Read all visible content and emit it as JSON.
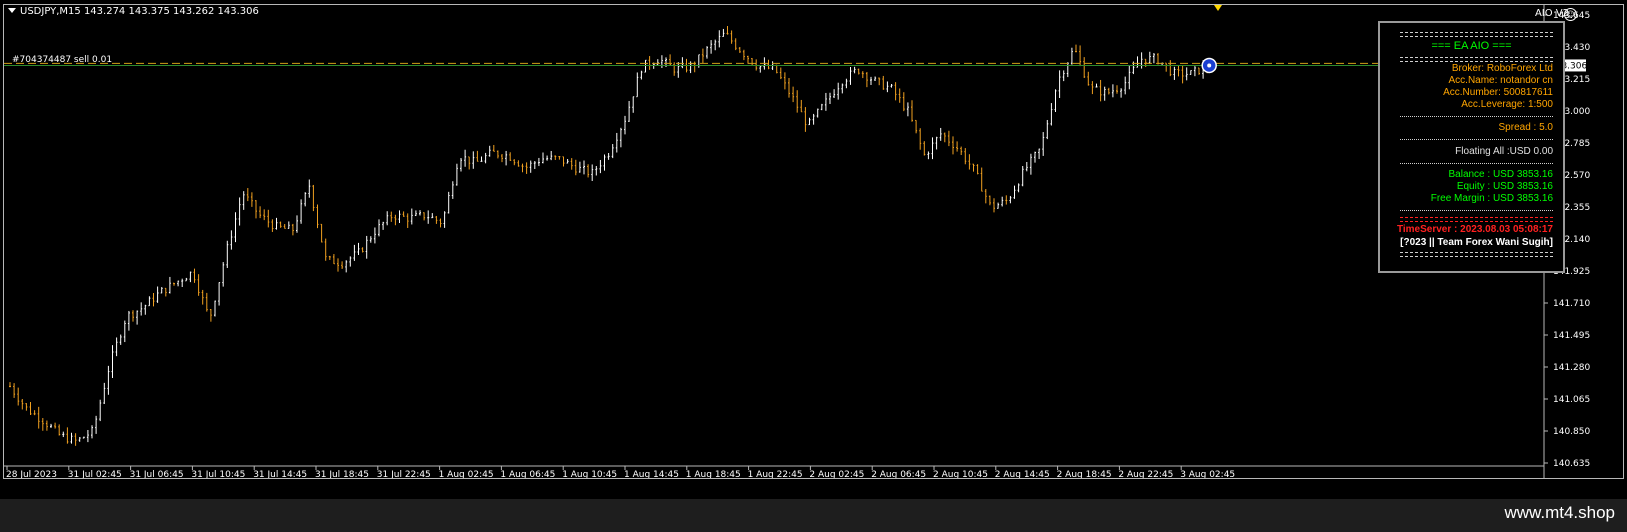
{
  "header": {
    "symbol_line": "USDJPY,M15  143.274 143.375 143.262 143.306",
    "ea_name": "AIO V2"
  },
  "order_label": "#704374487 sell 0.01",
  "watermark": "www.mt4.shop",
  "colors": {
    "background": "#000000",
    "bull_candle": "#ffffff",
    "bear_candle": "#f0a020",
    "order_line": "#d4a017",
    "bid_line": "#2e8b2e",
    "panel_title": "#00ff00",
    "panel_orange": "#ffa500",
    "panel_red": "#ff2020"
  },
  "info_panel": {
    "top_sep": "============================",
    "title": "=== EA AIO ===",
    "sep2": "============================",
    "broker": "Broker: RoboForex Ltd",
    "acc_name": "Acc.Name: notandor cn",
    "acc_number": "Acc.Number: 500817611",
    "acc_leverage": "Acc.Leverage: 1:500",
    "spread": "Spread :  5.0",
    "floating": "Floating All  :USD 0.00",
    "balance": "Balance  : USD 3853.16",
    "equity": "Equity  : USD 3853.16",
    "free_margin": "Free Margin : USD 3853.16",
    "red_sep": "============================",
    "time_server": "TimeServer : 2023.08.03 05:08:17",
    "team": "[?023 || Team Forex Wani Sugih]",
    "bottom_sep": "============================"
  },
  "chart_data": {
    "type": "candlestick",
    "symbol": "USDJPY",
    "timeframe": "M15",
    "current_price": 143.306,
    "order_price": 143.32,
    "ylim": [
      140.6,
      143.68
    ],
    "y_ticks": [
      "143.645",
      "143.430",
      "143.215",
      "143.000",
      "142.785",
      "142.570",
      "142.355",
      "142.140",
      "141.925",
      "141.710",
      "141.495",
      "141.280",
      "141.065",
      "140.850",
      "140.635"
    ],
    "current_price_label": "143.306",
    "x_ticks": [
      "28 Jul 2023",
      "31 Jul 02:45",
      "31 Jul 06:45",
      "31 Jul 10:45",
      "31 Jul 14:45",
      "31 Jul 18:45",
      "31 Jul 22:45",
      "1 Aug 02:45",
      "1 Aug 06:45",
      "1 Aug 10:45",
      "1 Aug 14:45",
      "1 Aug 18:45",
      "1 Aug 22:45",
      "2 Aug 02:45",
      "2 Aug 06:45",
      "2 Aug 10:45",
      "2 Aug 14:45",
      "2 Aug 18:45",
      "2 Aug 22:45",
      "3 Aug 02:45"
    ],
    "path_closes": [
      141.15,
      141.0,
      140.92,
      140.82,
      140.78,
      140.85,
      141.3,
      141.62,
      141.68,
      141.78,
      141.85,
      141.92,
      141.6,
      142.05,
      142.45,
      142.3,
      142.22,
      142.2,
      142.5,
      142.0,
      141.98,
      142.05,
      142.2,
      142.3,
      142.28,
      142.3,
      142.25,
      142.7,
      142.65,
      142.72,
      142.7,
      142.62,
      142.68,
      142.68,
      142.62,
      142.58,
      142.72,
      142.95,
      143.3,
      143.35,
      143.28,
      143.3,
      143.42,
      143.52,
      143.4,
      143.3,
      143.28,
      143.1,
      142.9,
      143.05,
      143.2,
      143.28,
      143.2,
      143.15,
      143.0,
      142.7,
      142.85,
      142.75,
      142.6,
      142.35,
      142.4,
      142.6,
      142.75,
      143.2,
      143.42,
      143.15,
      143.12,
      143.18,
      143.35,
      143.35,
      143.25,
      143.25,
      143.3
    ]
  }
}
